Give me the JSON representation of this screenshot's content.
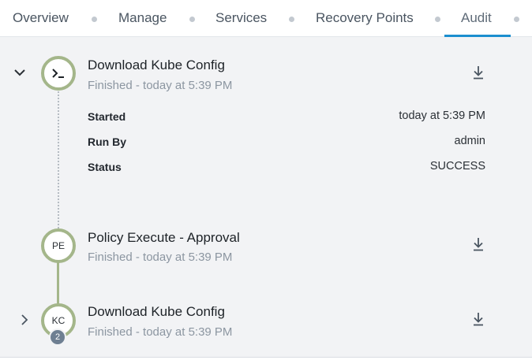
{
  "tabs": [
    {
      "label": "Overview"
    },
    {
      "label": "Manage"
    },
    {
      "label": "Services"
    },
    {
      "label": "Recovery Points"
    },
    {
      "label": "Audit",
      "active": true
    }
  ],
  "colors": {
    "accent": "#1b8ecf",
    "success_ring": "#a4b68a",
    "badge": "#6e7f92",
    "panel_bg": "#f2f3f5"
  },
  "audit": {
    "items": [
      {
        "icon": "terminal-icon",
        "title": "Download Kube Config",
        "subtitle": "Finished - today at 5:39 PM",
        "expanded": true,
        "details": [
          {
            "label": "Started",
            "value": "today at 5:39 PM"
          },
          {
            "label": "Run By",
            "value": "admin"
          },
          {
            "label": "Status",
            "value": "SUCCESS"
          }
        ]
      },
      {
        "initials": "PE",
        "title": "Policy Execute - Approval",
        "subtitle": "Finished - today at 5:39 PM"
      },
      {
        "initials": "KC",
        "badge": "2",
        "title": "Download Kube Config",
        "subtitle": "Finished - today at 5:39 PM",
        "expanded": false
      }
    ]
  }
}
